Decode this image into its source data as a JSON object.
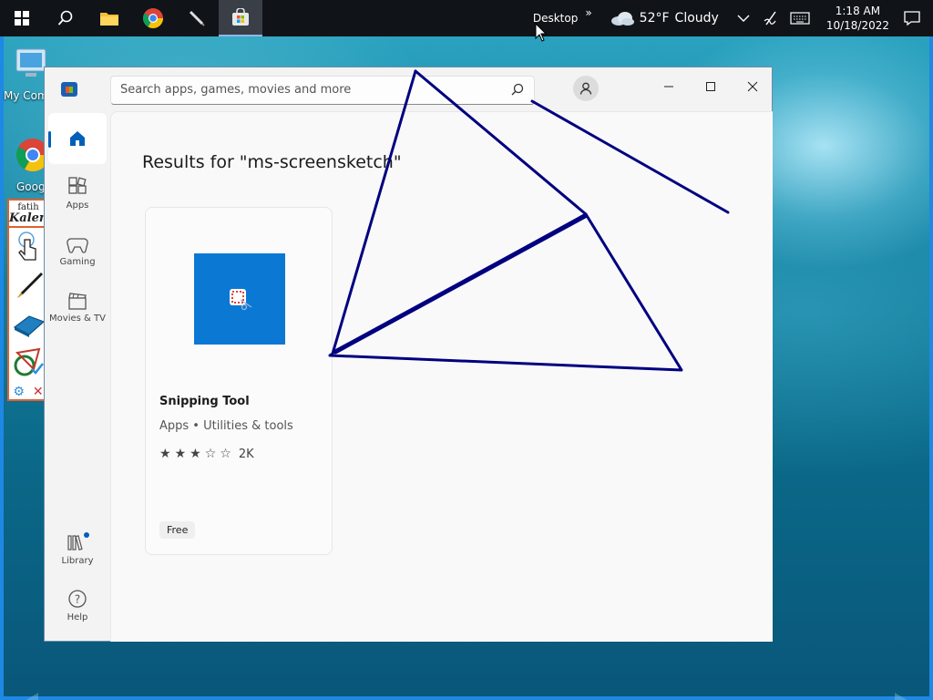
{
  "taskbar": {
    "desktop_label": "Desktop",
    "overflow": "»",
    "weather_temp": "52°F",
    "weather_desc": "Cloudy",
    "time": "1:18 AM",
    "date": "10/18/2022"
  },
  "desktop": {
    "icon_my_computer": "My Com",
    "icon_chrome": "Goog"
  },
  "fatih_kalem": {
    "logo_top": "fatih",
    "logo_bottom": "Kalem",
    "close": "✕"
  },
  "store": {
    "search_placeholder": "Search apps, games, movies and more",
    "sidebar": [
      {
        "label": ""
      },
      {
        "label": "Apps"
      },
      {
        "label": "Gaming"
      },
      {
        "label": "Movies & TV"
      },
      {
        "label": "Library"
      },
      {
        "label": "Help"
      }
    ],
    "results_title": "Results for \"ms-screensketch\"",
    "app": {
      "name": "Snipping Tool",
      "category": "Apps • Utilities & tools",
      "rating": 3,
      "rating_max": 5,
      "rating_count": "2K",
      "price": "Free"
    }
  },
  "colors": {
    "accent": "#005fb8",
    "app_tile": "#0b78d4",
    "annotation": "#000080"
  }
}
